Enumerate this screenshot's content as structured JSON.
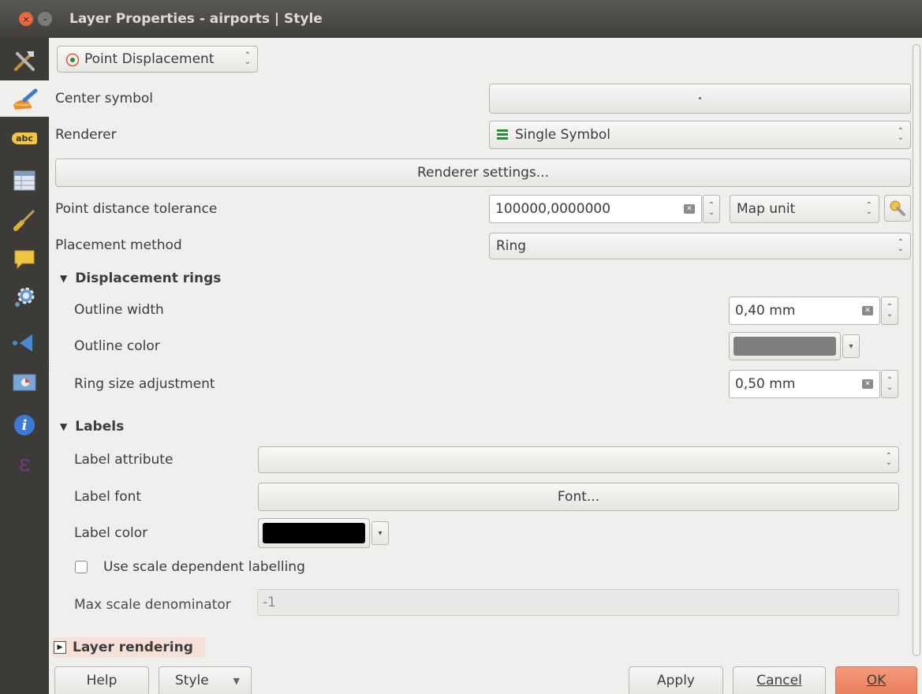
{
  "window": {
    "title": "Layer Properties - airports | Style",
    "close_glyph": "×",
    "minimize_glyph": "–"
  },
  "sidebar": {
    "items": [
      {
        "icon": "tools-icon"
      },
      {
        "icon": "paintbrush-style-icon"
      },
      {
        "icon": "labels-abc-icon",
        "text": "abc"
      },
      {
        "icon": "fields-table-icon"
      },
      {
        "icon": "rendering-brush-icon"
      },
      {
        "icon": "display-tooltip-icon"
      },
      {
        "icon": "actions-gear-icon"
      },
      {
        "icon": "joins-icon"
      },
      {
        "icon": "diagrams-icon"
      },
      {
        "icon": "information-icon",
        "text": "i"
      },
      {
        "icon": "variables-epsilon-icon",
        "text": "ε"
      }
    ]
  },
  "renderer_type": {
    "value": "Point Displacement"
  },
  "center_symbol": {
    "label": "Center symbol",
    "preview": "•"
  },
  "renderer": {
    "label": "Renderer",
    "value": "Single Symbol"
  },
  "renderer_settings": {
    "label": "Renderer settings..."
  },
  "tolerance": {
    "label": "Point distance tolerance",
    "value": "100000,0000000",
    "unit": "Map unit"
  },
  "placement": {
    "label": "Placement method",
    "value": "Ring"
  },
  "displacement_rings": {
    "title": "Displacement rings",
    "outline_width_label": "Outline width",
    "outline_width_value": "0,40 mm",
    "outline_color_label": "Outline color",
    "outline_color": "#7f7f7f",
    "ring_size_label": "Ring size adjustment",
    "ring_size_value": "0,50 mm"
  },
  "labels": {
    "title": "Labels",
    "attribute_label": "Label attribute",
    "attribute_value": "",
    "font_label": "Label font",
    "font_button": "Font...",
    "color_label": "Label color",
    "color": "#000000",
    "scale_dependent_label": "Use scale dependent labelling",
    "scale_dependent_checked": false,
    "max_scale_label": "Max scale denominator",
    "max_scale_value": "-1"
  },
  "layer_rendering": {
    "title": "Layer rendering"
  },
  "footer": {
    "help": "Help",
    "style": "Style",
    "apply": "Apply",
    "cancel": "Cancel",
    "ok": "OK"
  },
  "colors": {
    "titlebar": "#4a4945",
    "sidebar": "#3c3b37",
    "accent_ok": "#ef8c6a"
  }
}
